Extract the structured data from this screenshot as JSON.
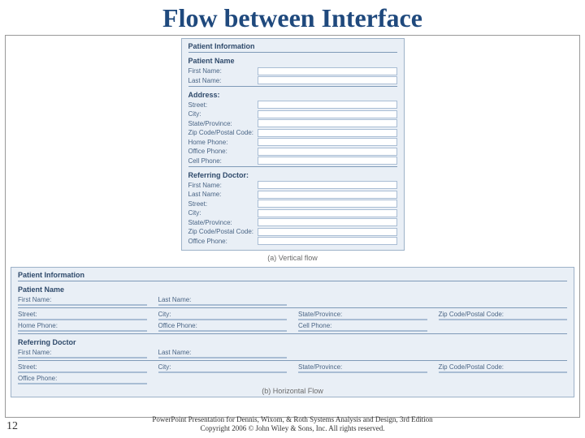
{
  "title": "Flow between Interface",
  "page_number": "12",
  "vcaption": "(a) Vertical flow",
  "hcaption": "(b) Horizontal Flow",
  "credit_line1": "PowerPoint Presentation for Dennis, Wixom, & Roth Systems Analysis and Design, 3rd Edition",
  "credit_line2": "Copyright 2006 © John Wiley & Sons, Inc.  All rights reserved.",
  "headers": {
    "patient_info": "Patient Information",
    "patient_name": "Patient Name",
    "address": "Address:",
    "referring_doctor": "Referring Doctor:",
    "referring_doctor_h": "Referring Doctor"
  },
  "labels": {
    "first_name": "First Name:",
    "last_name": "Last Name:",
    "street": "Street:",
    "city": "City:",
    "state": "State/Province:",
    "zip": "Zip Code/Postal Code:",
    "home_phone": "Home Phone:",
    "office_phone": "Office Phone:",
    "cell_phone": "Cell Phone:"
  }
}
